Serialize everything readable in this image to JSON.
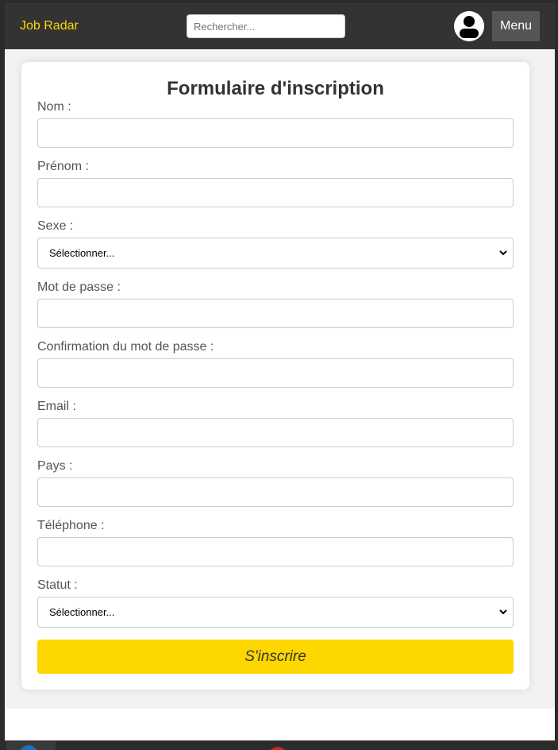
{
  "navbar": {
    "brand": "Job Radar",
    "search_placeholder": "Rechercher...",
    "menu_label": "Menu",
    "avatar_icon": "user-avatar-icon"
  },
  "form": {
    "title": "Formulaire d'inscription",
    "fields": {
      "nom": {
        "label": "Nom :",
        "value": ""
      },
      "prenom": {
        "label": "Prénom :",
        "value": ""
      },
      "sexe": {
        "label": "Sexe :",
        "selected": "Sélectionner..."
      },
      "mot_de_passe": {
        "label": "Mot de passe :",
        "value": ""
      },
      "confirmation": {
        "label": "Confirmation du mot de passe :",
        "value": ""
      },
      "email": {
        "label": "Email :",
        "value": ""
      },
      "pays": {
        "label": "Pays :",
        "value": ""
      },
      "telephone": {
        "label": "Téléphone :",
        "value": ""
      },
      "statut": {
        "label": "Statut :",
        "selected": "Sélectionner..."
      }
    },
    "submit_label": "S'inscrire"
  },
  "colors": {
    "navbar_bg": "#333333",
    "brand": "#ffd700",
    "submit_bg": "#ffd700",
    "page_bg": "#f2f2f2"
  }
}
